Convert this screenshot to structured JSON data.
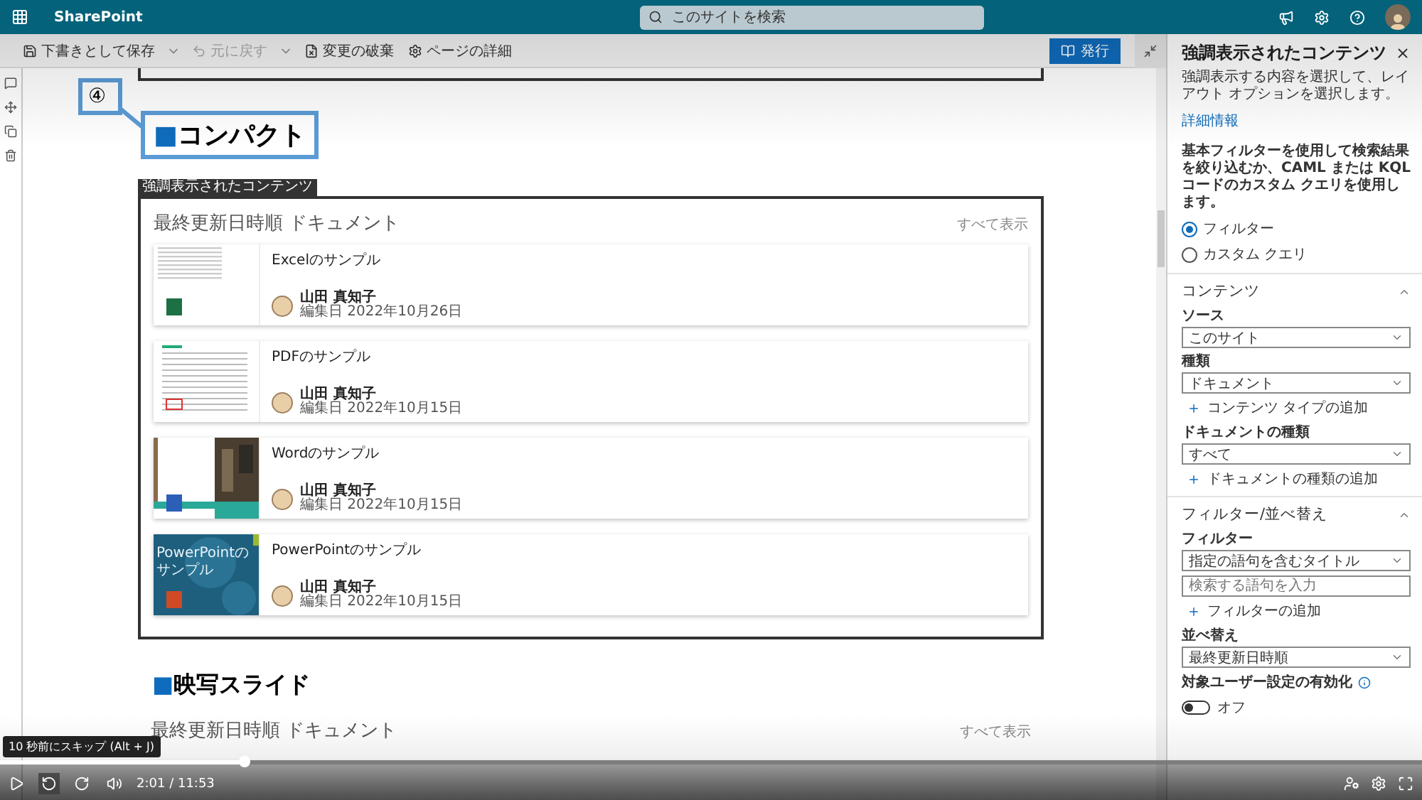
{
  "top_bar": {
    "app_name": "SharePoint",
    "search": {
      "placeholder": "このサイトを検索"
    }
  },
  "command_bar": {
    "items": [
      {
        "label": "下書きとして保存",
        "disabled": false
      },
      {
        "label": "元に戻す",
        "disabled": true
      },
      {
        "label": "変更の破棄",
        "disabled": false
      },
      {
        "label": "ページの詳細",
        "disabled": false
      }
    ],
    "publish_button": "発行"
  },
  "callout": {
    "number": "④",
    "marker": "■",
    "heading": "コンパクト"
  },
  "webpart": {
    "tag": "強調表示されたコンテンツ",
    "title": "最終更新日時順 ドキュメント",
    "see_all": "すべて表示",
    "documents": [
      {
        "kind": "excel",
        "title": "Excelのサンプル",
        "author": "山田 真知子",
        "edited": "編集日 2022年10月26日"
      },
      {
        "kind": "pdf",
        "title": "PDFのサンプル",
        "author": "山田 真知子",
        "edited": "編集日 2022年10月15日"
      },
      {
        "kind": "word",
        "title": "Wordのサンプル",
        "author": "山田 真知子",
        "edited": "編集日 2022年10月15日"
      },
      {
        "kind": "powerpoint",
        "title": "PowerPointのサンプル",
        "author": "山田 真知子",
        "edited": "編集日 2022年10月15日",
        "thumbnail_text": "PowerPointのサンプル"
      }
    ]
  },
  "section2": {
    "marker": "■",
    "heading": "映写スライド",
    "title": "最終更新日時順 ドキュメント",
    "see_all": "すべて表示"
  },
  "panel": {
    "title": "強調表示されたコンテンツ",
    "description": "強調表示する内容を選択して、レイアウト オプションを選択します。",
    "link": "詳細情報",
    "filter_text": "基本フィルターを使用して検索結果を絞り込むか、CAML または KQL コードのカスタム クエリを使用します。",
    "radios": [
      {
        "label": "フィルター",
        "selected": true
      },
      {
        "label": "カスタム クエリ",
        "selected": false
      }
    ],
    "sections": [
      {
        "title": "コンテンツ",
        "expanded": true,
        "fields": [
          {
            "kind": "select",
            "label": "ソース",
            "value": "このサイト"
          },
          {
            "kind": "select",
            "label": "種類",
            "value": "ドキュメント"
          },
          {
            "kind": "add",
            "label": "コンテンツ タイプの追加"
          },
          {
            "kind": "select",
            "label": "ドキュメントの種類",
            "value": "すべて"
          },
          {
            "kind": "add",
            "label": "ドキュメントの種類の追加"
          }
        ]
      },
      {
        "title": "フィルター/並べ替え",
        "expanded": true,
        "fields": [
          {
            "kind": "select",
            "label": "フィルター",
            "value": "指定の語句を含むタイトル"
          },
          {
            "kind": "text",
            "placeholder": "検索する語句を入力"
          },
          {
            "kind": "add",
            "label": "フィルターの追加"
          },
          {
            "kind": "select",
            "label": "並べ替え",
            "value": "最終更新日時順"
          },
          {
            "kind": "toggle",
            "label": "対象ユーザー設定の有効化",
            "on": false,
            "state_text": "オフ"
          }
        ]
      }
    ]
  },
  "player": {
    "tooltip": "10 秒前にスキップ (Alt + J)",
    "time": "2:01 / 11:53",
    "level": 0.172
  }
}
